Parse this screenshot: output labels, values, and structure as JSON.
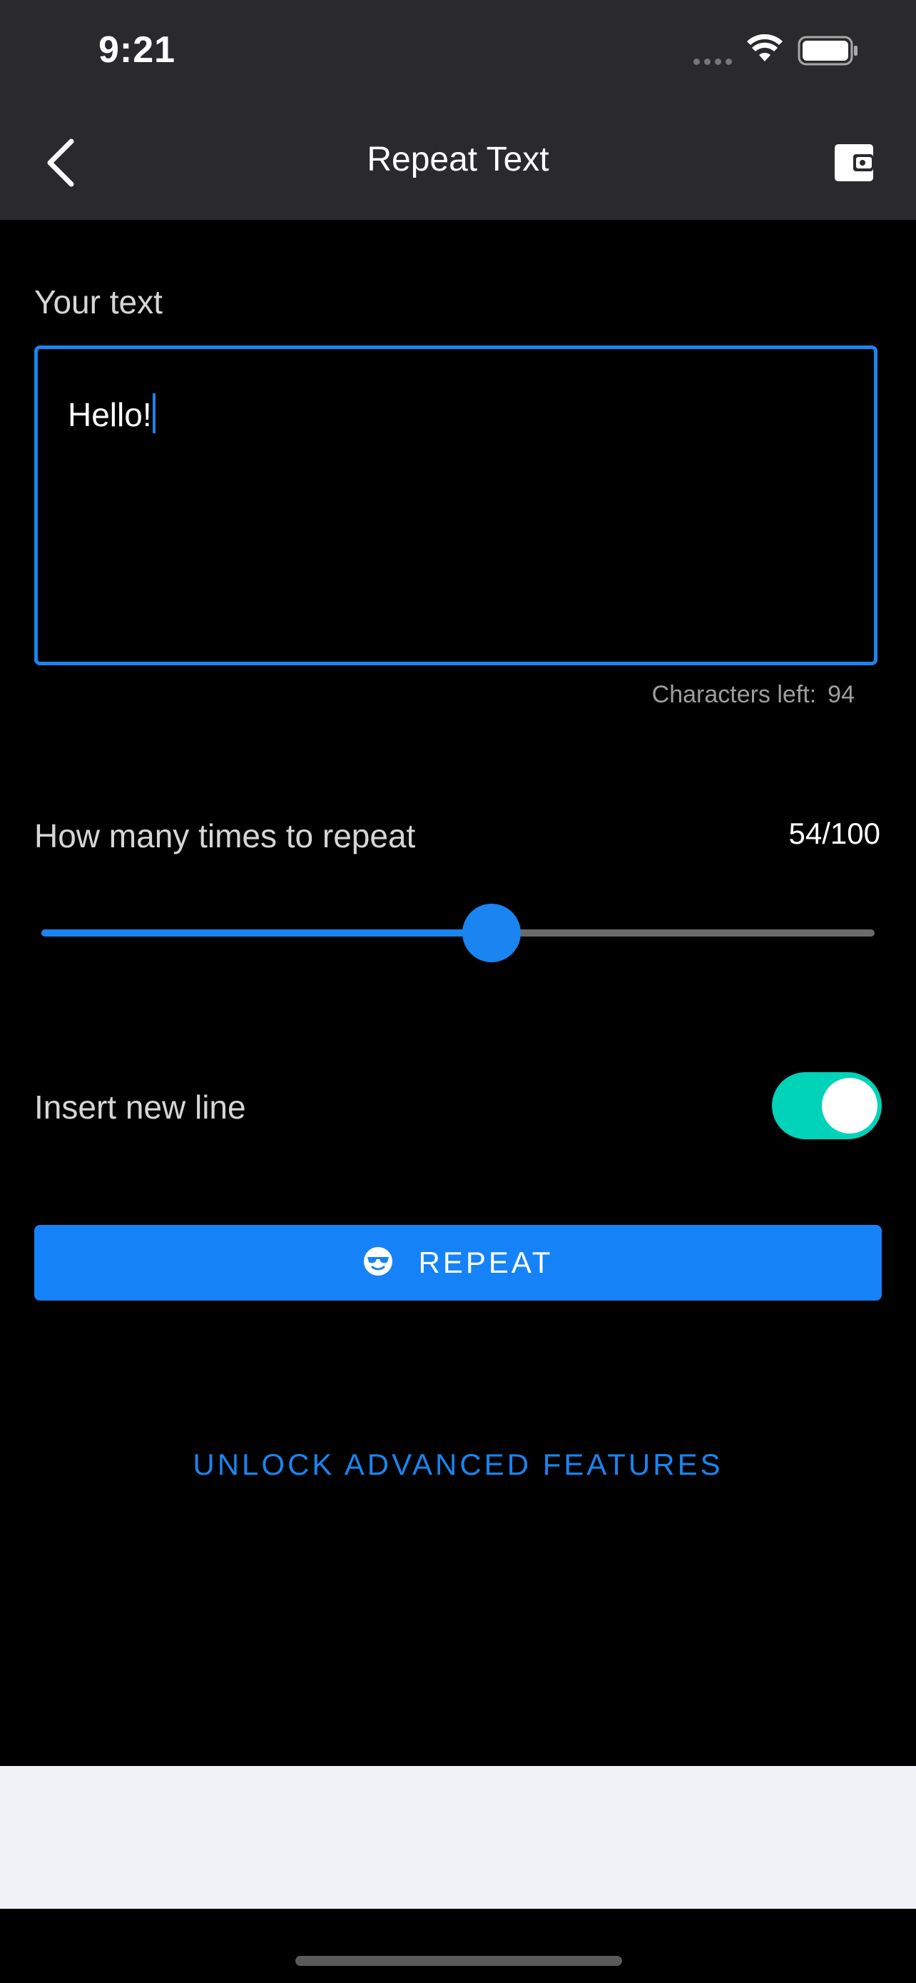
{
  "status_bar": {
    "time": "9:21",
    "icons": [
      "signal-dots-icon",
      "wifi-icon",
      "battery-icon"
    ]
  },
  "nav": {
    "title": "Repeat Text",
    "back_icon": "chevron-left-icon",
    "right_icon": "wallet-icon"
  },
  "text_input": {
    "label": "Your text",
    "value": "Hello!",
    "chars_left_label": "Characters left:",
    "chars_left_value": "94"
  },
  "repeat_slider": {
    "label": "How many times to repeat",
    "count_display": "54/100",
    "value": 54,
    "max": 100
  },
  "newline_toggle": {
    "label": "Insert new line",
    "on": true
  },
  "repeat_button": {
    "label": "REPEAT",
    "icon": "sunglasses-face-icon"
  },
  "unlock_link": {
    "label": "UNLOCK ADVANCED FEATURES"
  },
  "colors": {
    "accent": "#1a84f0",
    "toggle_on": "#00d3b8",
    "header_bg": "#2a2a2c",
    "background": "#000000"
  }
}
